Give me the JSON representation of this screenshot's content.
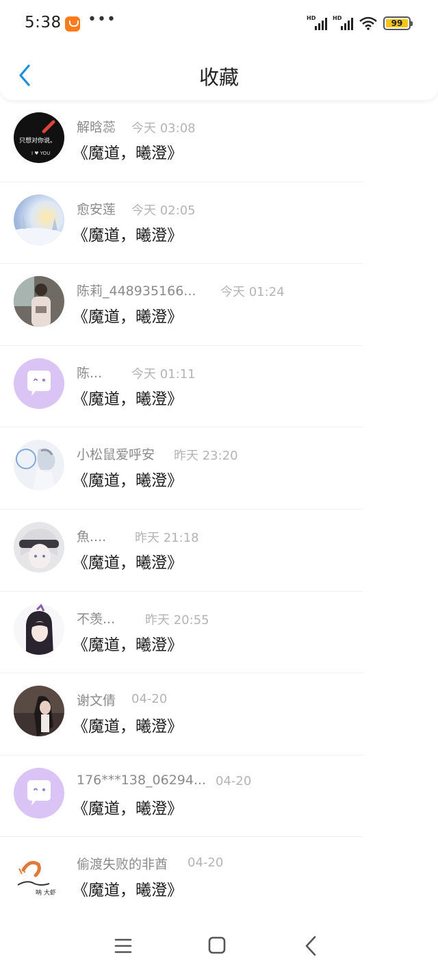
{
  "status_bar": {
    "time": "5:38",
    "signal_label_1": "HD",
    "signal_label_2": "HD",
    "battery_level": "99",
    "icons": [
      "shopping-app-icon",
      "more-dots-icon",
      "signal-icon",
      "signal-icon",
      "wifi-icon",
      "battery-icon"
    ],
    "colors": {
      "app_icon": "#ff7a1a",
      "battery": "#f5c518"
    }
  },
  "nav": {
    "title": "收藏",
    "back_icon": "chevron-left-icon",
    "accent_color": "#1a8fdd"
  },
  "favorites": [
    {
      "user": "解晗蕊",
      "time": "今天 03:08",
      "title": "《魔道，曦澄》",
      "avatar": "text-image-avatar"
    },
    {
      "user": "愈安莲",
      "time": "今天 02:05",
      "title": "《魔道，曦澄》",
      "avatar": "snow-scene-avatar"
    },
    {
      "user": "陈莉_448935166...",
      "time": "今天 01:24",
      "title": "《魔道，曦澄》",
      "avatar": "person-photo-avatar"
    },
    {
      "user": "陈...",
      "time": "今天 01:11",
      "title": "《魔道，曦澄》",
      "avatar": "default-chat-avatar"
    },
    {
      "user": "小松鼠爱呼安",
      "time": "昨天 23:20",
      "title": "《魔道，曦澄》",
      "avatar": "anime-avatar"
    },
    {
      "user": "魚....",
      "time": "昨天 21:18",
      "title": "《魔道，曦澄》",
      "avatar": "anime-avatar"
    },
    {
      "user": "不羡...",
      "time": "昨天 20:55",
      "title": "《魔道，曦澄》",
      "avatar": "anime-avatar"
    },
    {
      "user": "谢文倩",
      "time": "04-20",
      "title": "《魔道，曦澄》",
      "avatar": "person-photo-avatar"
    },
    {
      "user": "176***138_06294...",
      "time": "04-20",
      "title": "《魔道，曦澄》",
      "avatar": "default-chat-avatar"
    },
    {
      "user": "偷渡失败的非酋",
      "time": "04-20",
      "title": "《魔道，曦澄》",
      "avatar": "shrimp-drawing-avatar"
    }
  ],
  "bottom_nav": {
    "icons": [
      "menu-icon",
      "home-square-icon",
      "back-triangle-icon"
    ]
  }
}
